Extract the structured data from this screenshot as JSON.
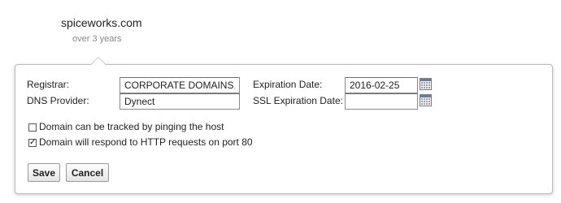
{
  "header": {
    "domain": "spiceworks.com",
    "age": "over 3 years"
  },
  "form": {
    "registrar_label": "Registrar:",
    "registrar_value": "CORPORATE DOMAINS, IN",
    "dns_label": "DNS Provider:",
    "dns_value": "Dynect",
    "expiration_label": "Expiration Date:",
    "expiration_value": "2016-02-25",
    "ssl_label": "SSL Expiration Date:",
    "ssl_value": "",
    "track_ping_label": "Domain can be tracked by pinging the host",
    "track_ping_checked": false,
    "http_label": "Domain will respond to HTTP requests on port 80",
    "http_checked": true,
    "calendar_icon": "calendar-icon"
  },
  "buttons": {
    "save": "Save",
    "cancel": "Cancel"
  }
}
